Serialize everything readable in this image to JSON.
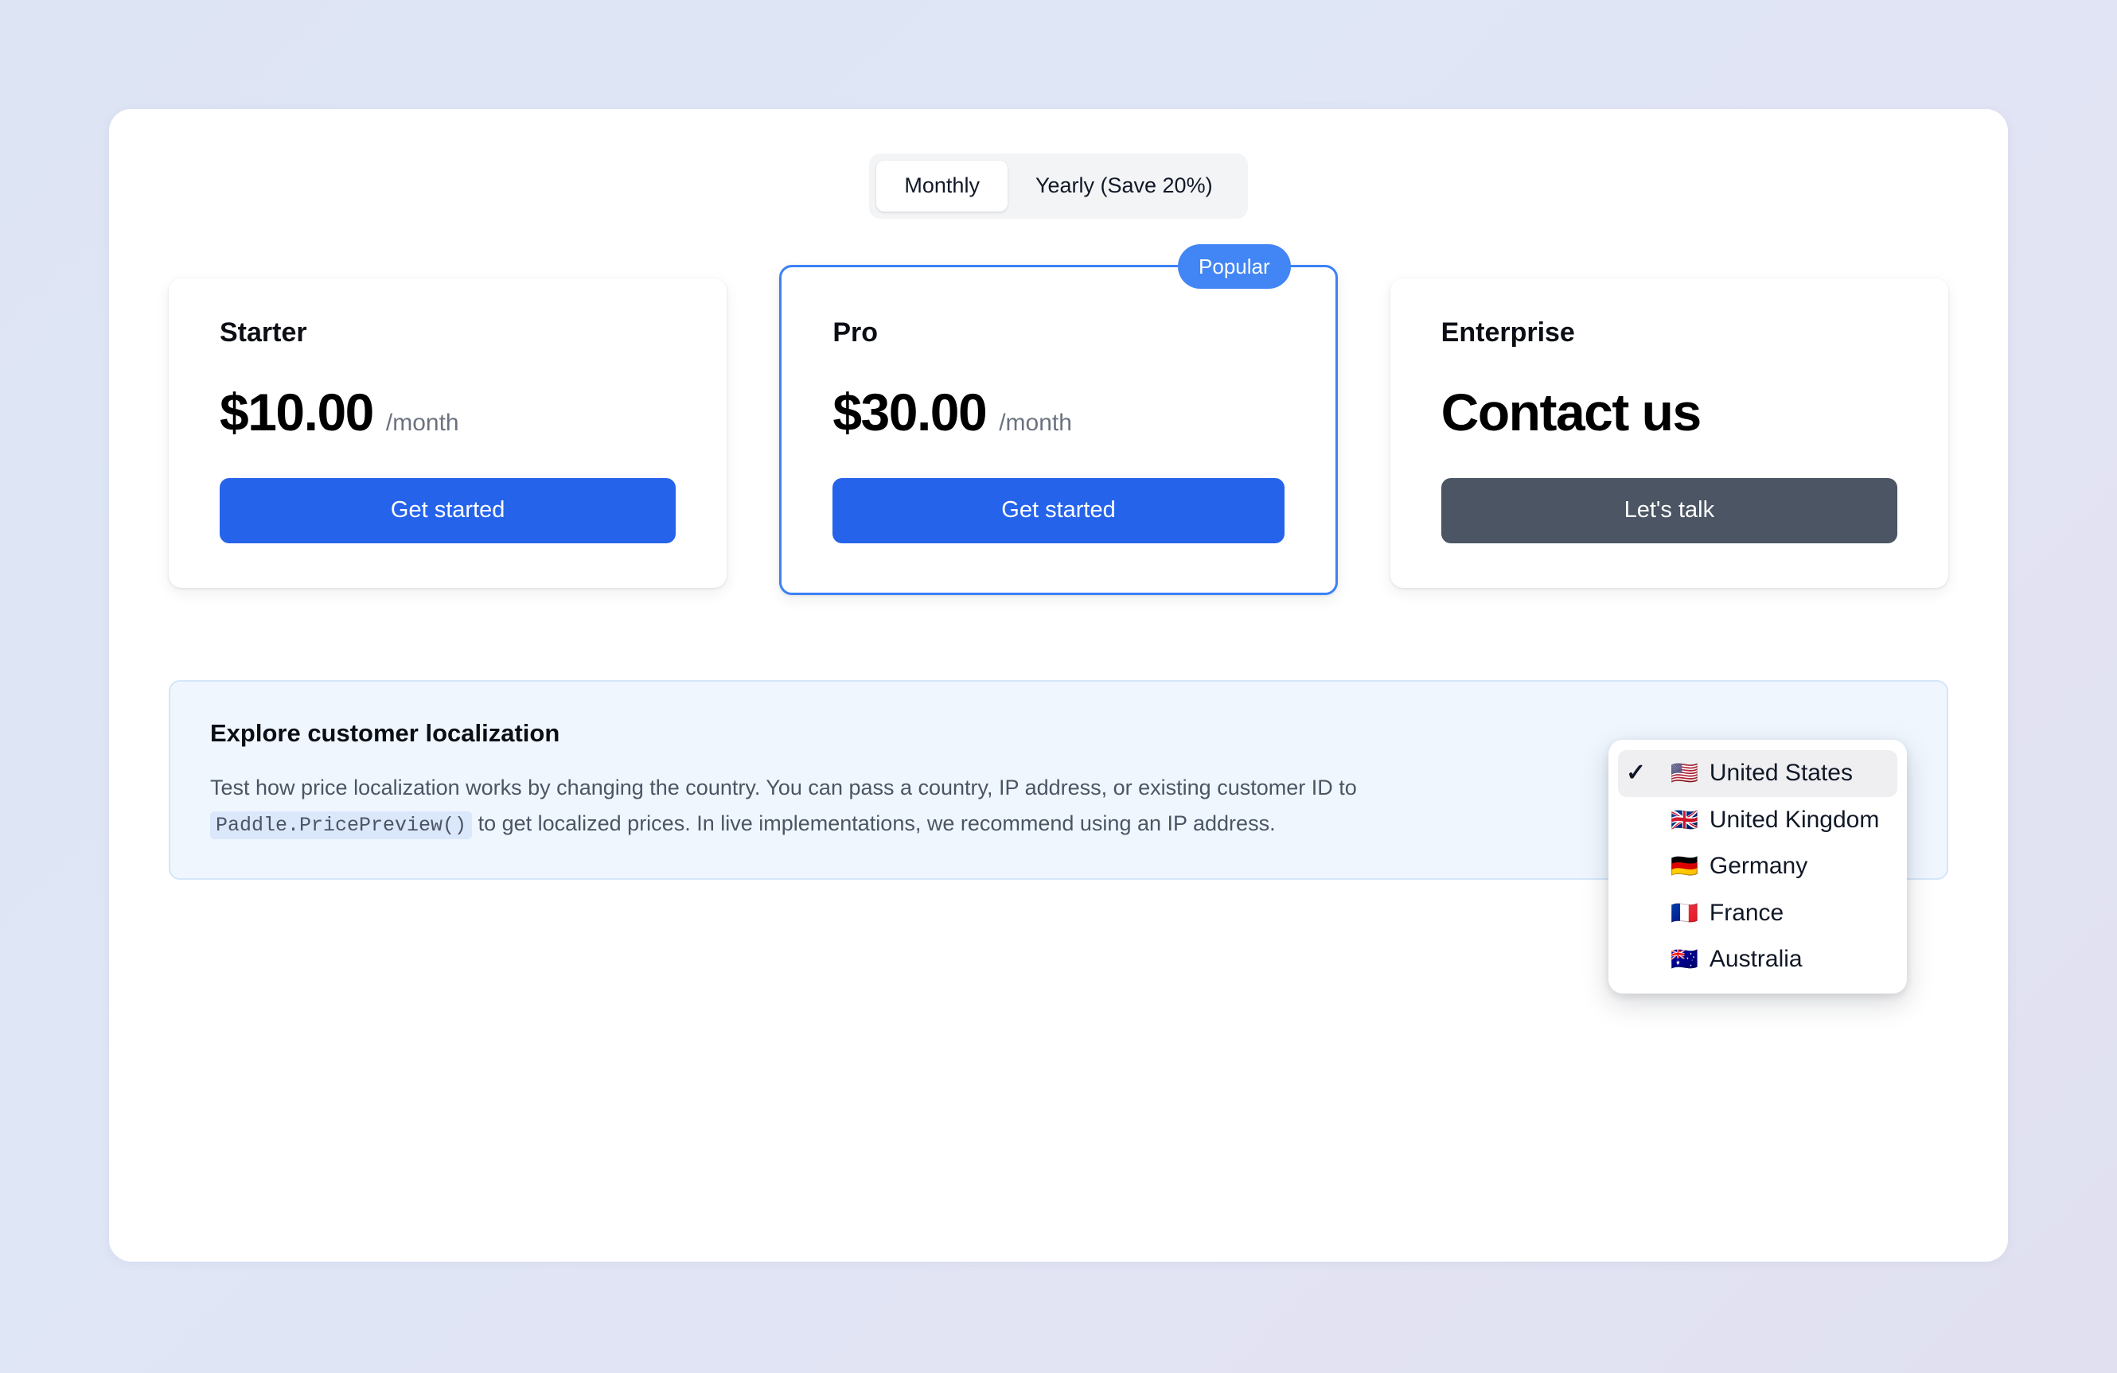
{
  "billing_toggle": {
    "options": [
      {
        "label": "Monthly",
        "active": true
      },
      {
        "label": "Yearly (Save 20%)",
        "active": false
      }
    ]
  },
  "plans": [
    {
      "name": "Starter",
      "price": "$10.00",
      "period": "/month",
      "cta_label": "Get started",
      "badge": null
    },
    {
      "name": "Pro",
      "price": "$30.00",
      "period": "/month",
      "cta_label": "Get started",
      "badge": "Popular"
    },
    {
      "name": "Enterprise",
      "price": "Contact us",
      "period": "",
      "cta_label": "Let's talk",
      "badge": null
    }
  ],
  "localization": {
    "title": "Explore customer localization",
    "body_before_code": "Test how price localization works by changing the country. You can pass a country, IP address, or existing customer ID to ",
    "code": "Paddle.PricePreview()",
    "body_after_code": " to get localized prices. In live implementations, we recommend using an IP address."
  },
  "country_dropdown": {
    "selected": "United States",
    "check_glyph": "✓",
    "items": [
      {
        "flag": "🇺🇸",
        "label": "United States",
        "selected": true
      },
      {
        "flag": "🇬🇧",
        "label": "United Kingdom",
        "selected": false
      },
      {
        "flag": "🇩🇪",
        "label": "Germany",
        "selected": false
      },
      {
        "flag": "🇫🇷",
        "label": "France",
        "selected": false
      },
      {
        "flag": "🇦🇺",
        "label": "Australia",
        "selected": false
      }
    ]
  },
  "colors": {
    "accent_blue": "#2563eb",
    "badge_blue": "#4285f4",
    "card_border_blue": "#3b82f6",
    "enterprise_gray": "#4b5563",
    "panel_bg": "#eff6fe",
    "page_bg": "#dde4f4"
  }
}
